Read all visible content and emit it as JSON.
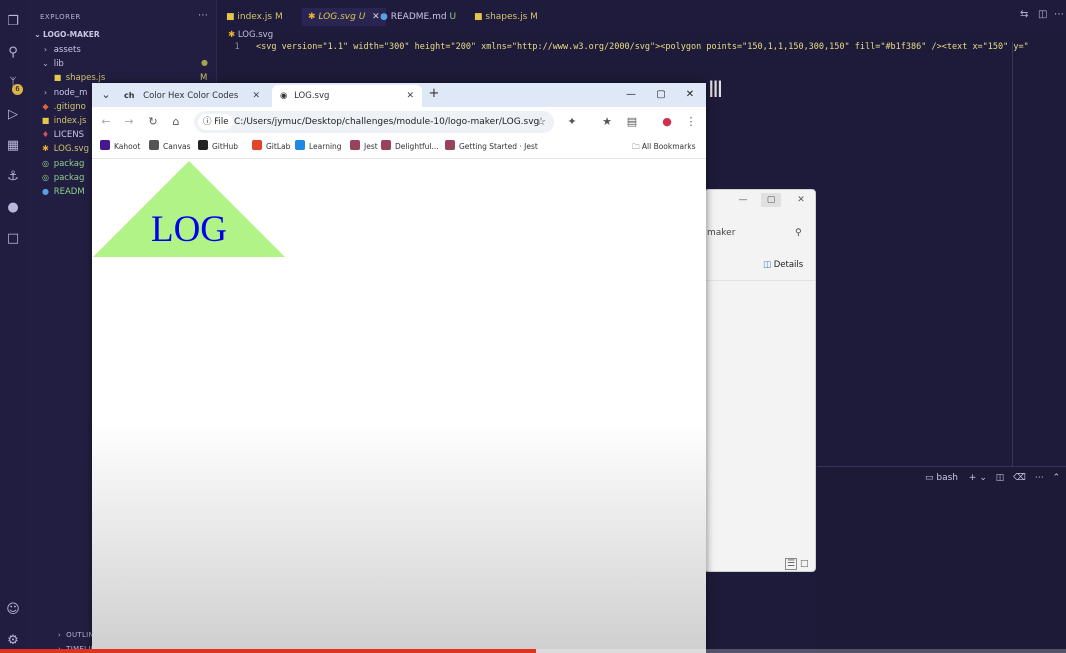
{
  "explorer": {
    "title": "EXPLORER",
    "project": "LOGO-MAKER",
    "items": [
      {
        "label": "assets",
        "icon": "chevron-right-icon",
        "mark": ""
      },
      {
        "label": "lib",
        "icon": "chevron-down-icon",
        "mark": ""
      },
      {
        "label": "shapes.js",
        "icon": "js-file-icon",
        "mark": "M"
      },
      {
        "label": "node_m",
        "icon": "chevron-right-icon",
        "mark": ""
      },
      {
        "label": ".gitigno",
        "icon": "git-file-icon",
        "mark": ""
      },
      {
        "label": "index.js",
        "icon": "js-file-icon",
        "mark": ""
      },
      {
        "label": "LICENS",
        "icon": "license-file-icon",
        "mark": ""
      },
      {
        "label": "LOG.svg",
        "icon": "svg-file-icon",
        "mark": ""
      },
      {
        "label": "packag",
        "icon": "json-file-icon",
        "mark": ""
      },
      {
        "label": "packag",
        "icon": "json-file-icon",
        "mark": ""
      },
      {
        "label": "READM",
        "icon": "info-file-icon",
        "mark": ""
      }
    ],
    "outline": "OUTLINE",
    "timeline": "TIMELINE"
  },
  "editor": {
    "tabs": [
      {
        "label": "index.js",
        "status": "M"
      },
      {
        "label": "LOG.svg",
        "status": "U"
      },
      {
        "label": "README.md",
        "status": "U"
      },
      {
        "label": "shapes.js",
        "status": "M"
      }
    ],
    "breadcrumb": "LOG.svg",
    "line_number": "1",
    "code_line": "<svg version=\"1.1\" width=\"300\" height=\"200\" xmlns=\"http://www.w3.org/2000/svg\"><polygon points=\"150,1,1,150,300,150\" fill=\"#b1f386\" /><text x=\"150\" y=\""
  },
  "terminal": {
    "shell": "bash"
  },
  "file_explorer": {
    "search_text": "maker",
    "details_label": "Details"
  },
  "browser": {
    "tabs": [
      {
        "label": "Color Hex Color Codes",
        "favicon": "ch"
      },
      {
        "label": "LOG.svg",
        "favicon": "globe-icon"
      }
    ],
    "address_chip": "File",
    "address_url": "C:/Users/jymuc/Desktop/challenges/module-10/logo-maker/LOG.svg",
    "bookmarks": [
      {
        "label": "Kahoot",
        "color": "#46178f"
      },
      {
        "label": "Canvas",
        "color": "#555555"
      },
      {
        "label": "GitHub",
        "color": "#222222"
      },
      {
        "label": "GitLab",
        "color": "#e2432a"
      },
      {
        "label": "Learning",
        "color": "#1e88e5"
      },
      {
        "label": "Jest ·",
        "color": "#99425b"
      },
      {
        "label": "Delightful...",
        "color": "#99425b"
      },
      {
        "label": "Getting Started · Jest",
        "color": "#99425b"
      }
    ],
    "all_bookmarks": "All Bookmarks"
  },
  "svg_render": {
    "text": "LOG",
    "shape_fill": "#b1f386",
    "text_fill": "#0000ee"
  },
  "video": {
    "progress": 0.503
  }
}
